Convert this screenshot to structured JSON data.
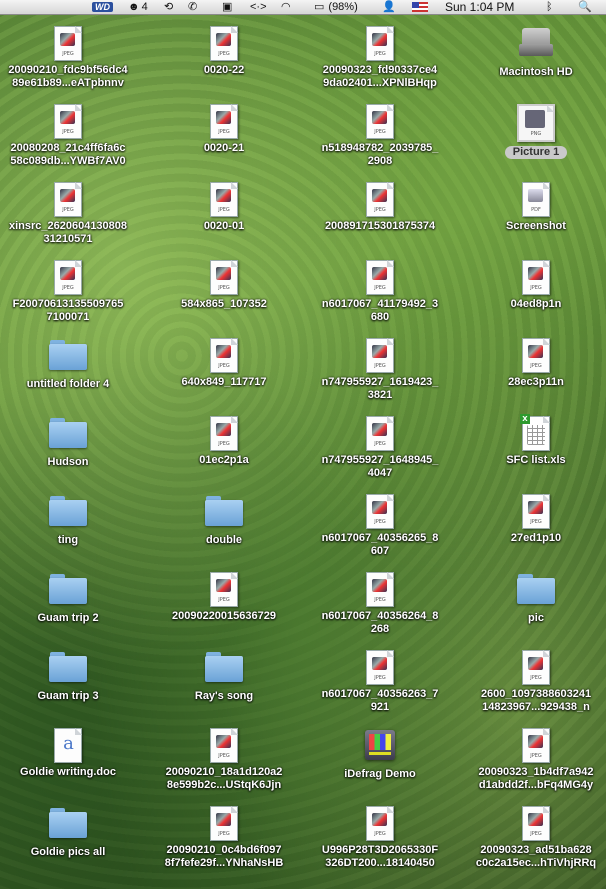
{
  "menubar": {
    "wd_label": "WD",
    "badge_count": "4",
    "battery": "(98%)",
    "clock": "Sun 1:04 PM"
  },
  "desktop": {
    "items": [
      {
        "label": "20090210_fdc9bf56dc4\n89e61b89...eATpbnnv",
        "icon": "jpeg-document-icon"
      },
      {
        "label": "0020-22",
        "icon": "jpeg-document-icon"
      },
      {
        "label": "20090323_fd90337ce4\n9da02401...XPNlBHqp",
        "icon": "jpeg-document-icon"
      },
      {
        "label": "Macintosh HD",
        "icon": "hard-drive-icon"
      },
      {
        "label": "20080208_21c4ff6fa6c\n58c089db...YWBf7AV0",
        "icon": "jpeg-document-icon"
      },
      {
        "label": "0020-21",
        "icon": "jpeg-document-icon"
      },
      {
        "label": "n518948782_2039785_\n2908",
        "icon": "jpeg-document-icon"
      },
      {
        "label": "Picture 1",
        "icon": "png-document-icon",
        "selected": true
      },
      {
        "label": "xinsrc_2620604130808\n31210571",
        "icon": "jpeg-document-icon"
      },
      {
        "label": "0020-01",
        "icon": "jpeg-document-icon"
      },
      {
        "label": "200891715301875374",
        "icon": "jpeg-document-icon"
      },
      {
        "label": "Screenshot",
        "icon": "pdf-document-icon"
      },
      {
        "label": "F20070613135509765\n7100071",
        "icon": "jpeg-document-icon"
      },
      {
        "label": "584x865_107352",
        "icon": "jpeg-document-icon"
      },
      {
        "label": "n6017067_41179492_3\n680",
        "icon": "jpeg-document-icon"
      },
      {
        "label": "04ed8p1n",
        "icon": "jpeg-document-icon"
      },
      {
        "label": "untitled folder 4",
        "icon": "folder-icon"
      },
      {
        "label": "640x849_117717",
        "icon": "jpeg-document-icon"
      },
      {
        "label": "n747955927_1619423_\n3821",
        "icon": "jpeg-document-icon"
      },
      {
        "label": "28ec3p11n",
        "icon": "jpeg-document-icon"
      },
      {
        "label": "Hudson",
        "icon": "folder-icon"
      },
      {
        "label": "01ec2p1a",
        "icon": "jpeg-document-icon"
      },
      {
        "label": "n747955927_1648945_\n4047",
        "icon": "jpeg-document-icon"
      },
      {
        "label": "SFC list.xls",
        "icon": "xls-document-icon"
      },
      {
        "label": "ting",
        "icon": "folder-icon"
      },
      {
        "label": "double",
        "icon": "folder-icon"
      },
      {
        "label": "n6017067_40356265_8\n607",
        "icon": "jpeg-document-icon"
      },
      {
        "label": "27ed1p10",
        "icon": "jpeg-document-icon"
      },
      {
        "label": "Guam trip 2",
        "icon": "folder-icon"
      },
      {
        "label": "20090220015636729",
        "icon": "jpeg-document-icon"
      },
      {
        "label": "n6017067_40356264_8\n268",
        "icon": "jpeg-document-icon"
      },
      {
        "label": "pic",
        "icon": "folder-icon"
      },
      {
        "label": "Guam trip 3",
        "icon": "folder-icon"
      },
      {
        "label": "Ray's song",
        "icon": "folder-icon"
      },
      {
        "label": "n6017067_40356263_7\n921",
        "icon": "jpeg-document-icon"
      },
      {
        "label": "2600_1097388603241\n14823967...929438_n",
        "icon": "jpeg-document-icon"
      },
      {
        "label": "Goldie writing.doc",
        "icon": "word-document-icon"
      },
      {
        "label": "20090210_18a1d120a2\n8e599b2c...UStqK6Jjn",
        "icon": "jpeg-document-icon"
      },
      {
        "label": "iDefrag Demo",
        "icon": "app-icon"
      },
      {
        "label": "20090323_1b4df7a942\nd1abdd2f...bFq4MG4y",
        "icon": "jpeg-document-icon"
      },
      {
        "label": "Goldie pics all",
        "icon": "folder-icon"
      },
      {
        "label": "20090210_0c4bd6f097\n8f7fefe29f...YNhaNsHB",
        "icon": "jpeg-document-icon"
      },
      {
        "label": "U996P28T3D2065330F\n326DT200...18140450",
        "icon": "jpeg-document-icon"
      },
      {
        "label": "20090323_ad51ba628\nc0c2a15ec...hTiVhjRRq",
        "icon": "jpeg-document-icon"
      }
    ]
  }
}
